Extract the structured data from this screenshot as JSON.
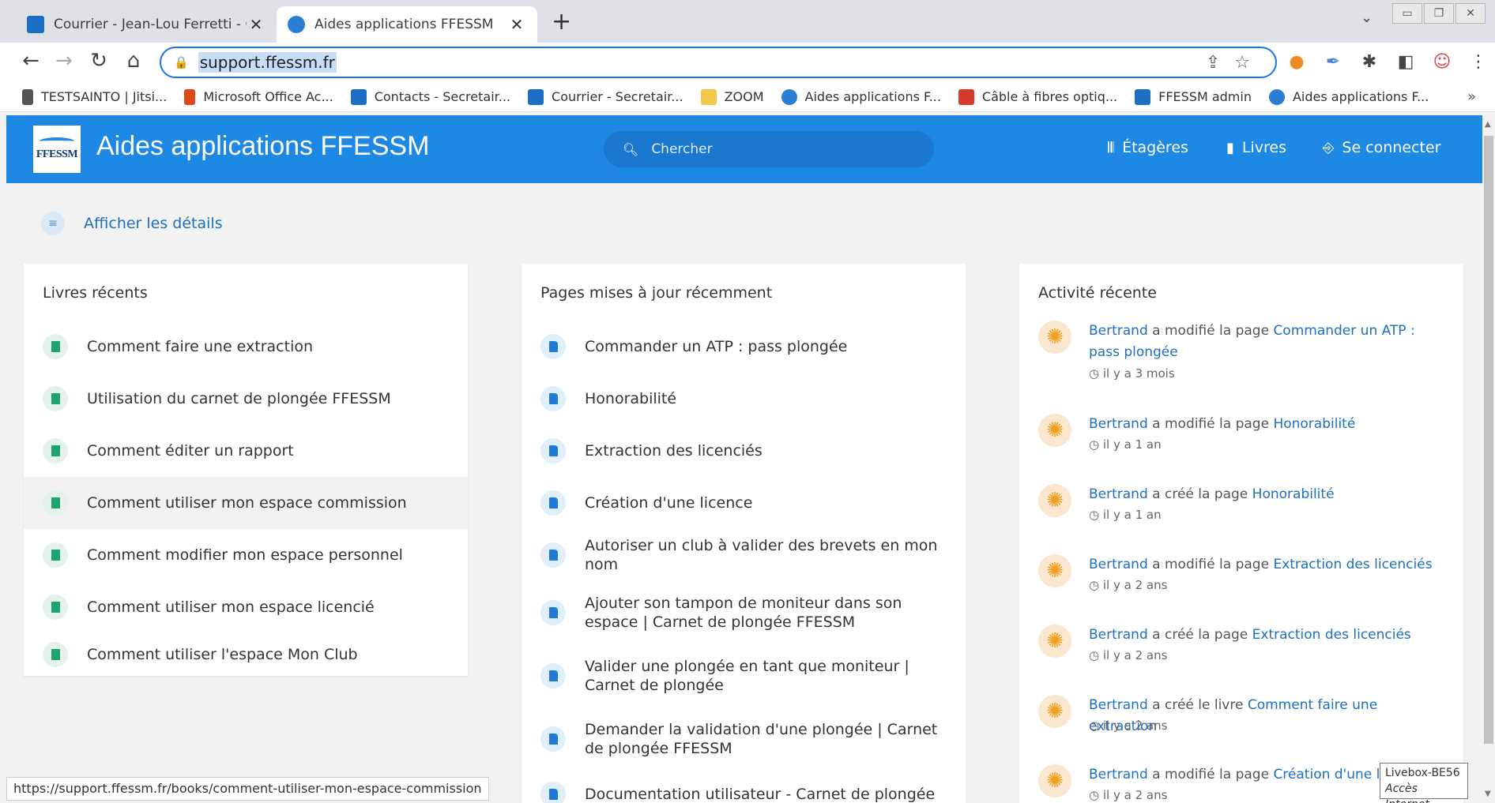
{
  "browser": {
    "tabs": [
      {
        "title": "Courrier - Jean-Lou Ferretti - Out",
        "active": false
      },
      {
        "title": "Aides applications FFESSM",
        "active": true
      }
    ],
    "new_tab": "+",
    "tab_close": "✕",
    "url": "support.ffessm.fr",
    "bookmarks": [
      "TESTSAINTO | Jitsi...",
      "Microsoft Office Ac...",
      "Contacts - Secretair...",
      "Courrier - Secretair...",
      "ZOOM",
      "Aides applications F...",
      "Câble à fibres optiq...",
      "FFESSM admin",
      "Aides applications F..."
    ],
    "bookmarks_more": "»"
  },
  "header": {
    "logo_text": "FFESSM",
    "title": "Aides applications FFESSM",
    "search_placeholder": "Chercher",
    "nav": {
      "shelves": "Étagères",
      "books": "Livres",
      "login": "Se connecter"
    }
  },
  "details_link": "Afficher les détails",
  "recent_books": {
    "title": "Livres récents",
    "items": [
      "Comment faire une extraction",
      "Utilisation du carnet de plongée FFESSM",
      "Comment éditer un rapport",
      "Comment utiliser mon espace commission",
      "Comment modifier mon espace personnel",
      "Comment utiliser mon espace licencié",
      "Comment utiliser l'espace Mon Club"
    ]
  },
  "recent_pages": {
    "title": "Pages mises à jour récemment",
    "items": [
      "Commander un ATP : pass plongée",
      "Honorabilité",
      "Extraction des licenciés",
      "Création d'une licence",
      "Autoriser un club à valider des brevets en mon nom",
      "Ajouter son tampon de moniteur dans son espace | Carnet de plongée FFESSM",
      "Valider une plongée en tant que moniteur | Carnet de plongée",
      "Demander la validation d'une plongée | Carnet de plongée FFESSM",
      "Documentation utilisateur - Carnet de plongée"
    ]
  },
  "activity": {
    "title": "Activité récente",
    "items": [
      {
        "user": "Bertrand",
        "action": "a modifié la page",
        "target": "Commander un ATP : pass plongée",
        "time": "il y a 3 mois"
      },
      {
        "user": "Bertrand",
        "action": "a modifié la page",
        "target": "Honorabilité",
        "time": "il y a 1 an"
      },
      {
        "user": "Bertrand",
        "action": "a créé la page",
        "target": "Honorabilité",
        "time": "il y a 1 an"
      },
      {
        "user": "Bertrand",
        "action": "a modifié la page",
        "target": "Extraction des licenciés",
        "time": "il y a 2 ans"
      },
      {
        "user": "Bertrand",
        "action": "a créé la page",
        "target": "Extraction des licenciés",
        "time": "il y a 2 ans"
      },
      {
        "user": "Bertrand",
        "action": "a créé le livre",
        "target": "Comment faire une extraction",
        "time": "il y a 2 ans"
      },
      {
        "user": "Bertrand",
        "action": "a modifié la page",
        "target": "Création d'une licence",
        "time": "il y a 2 ans"
      }
    ]
  },
  "status_url": "https://support.ffessm.fr/books/comment-utiliser-mon-espace-commission",
  "tooltip": {
    "line1": "Livebox-BE56",
    "line2": "Accès Internet"
  }
}
